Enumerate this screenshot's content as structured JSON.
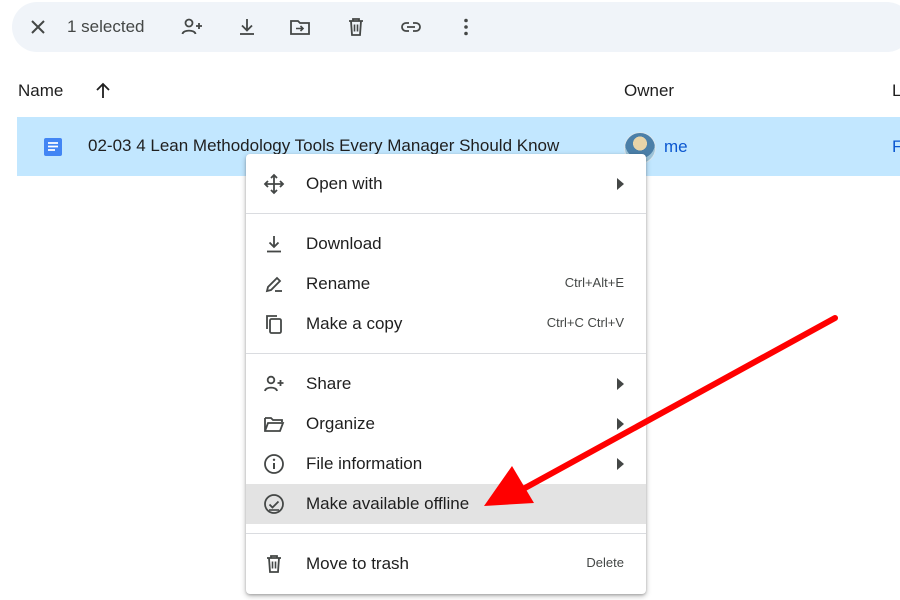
{
  "toolbar": {
    "selected_count": "1 selected",
    "actions": [
      "close-icon",
      "share-person-add-icon",
      "download-icon",
      "move-to-folder-icon",
      "trash-icon",
      "link-icon",
      "more-vert-icon"
    ]
  },
  "columns": {
    "name": "Name",
    "owner": "Owner",
    "last": "L"
  },
  "file_row": {
    "name": "02-03 4 Lean Methodology Tools Every Manager Should Know",
    "owner": "me",
    "clipped_text": "F",
    "icon": "google-doc-icon"
  },
  "context_menu": {
    "open_with": "Open with",
    "download": "Download",
    "rename": "Rename",
    "rename_shortcut": "Ctrl+Alt+E",
    "make_copy": "Make a copy",
    "make_copy_shortcut": "Ctrl+C Ctrl+V",
    "share": "Share",
    "organize": "Organize",
    "file_information": "File information",
    "make_offline": "Make available offline",
    "move_to_trash": "Move to trash",
    "move_to_trash_shortcut": "Delete"
  },
  "colors": {
    "selection": "#c2e7ff",
    "toolbar_bg": "#f0f4f9",
    "menu_hover": "#e3e3e3",
    "annotation_arrow": "#ff0000",
    "doc_blue": "#4285f4"
  }
}
